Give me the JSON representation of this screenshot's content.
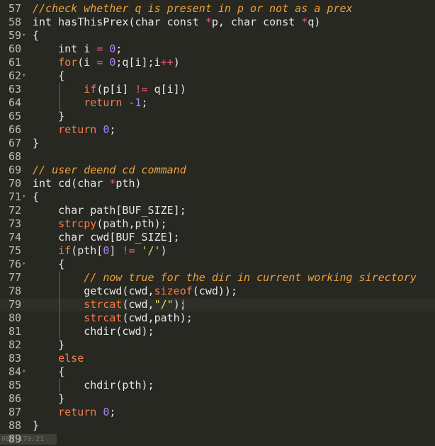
{
  "lines": [
    {
      "n": "57",
      "segs": [
        {
          "t": "//check whether q is present in p or not as a prex",
          "c": "cm"
        }
      ]
    },
    {
      "n": "58",
      "segs": [
        {
          "t": "int hasThisPrex(char const ",
          "c": ""
        },
        {
          "t": "*",
          "c": "op"
        },
        {
          "t": "p, char const ",
          "c": ""
        },
        {
          "t": "*",
          "c": "op"
        },
        {
          "t": "q)",
          "c": ""
        }
      ]
    },
    {
      "n": "59",
      "fold": true,
      "segs": [
        {
          "t": "{",
          "c": ""
        }
      ]
    },
    {
      "n": "60",
      "segs": [
        {
          "t": "    int i ",
          "c": ""
        },
        {
          "t": "=",
          "c": "op"
        },
        {
          "t": " ",
          "c": ""
        },
        {
          "t": "0",
          "c": "num"
        },
        {
          "t": ";",
          "c": ""
        }
      ]
    },
    {
      "n": "61",
      "segs": [
        {
          "t": "    ",
          "c": ""
        },
        {
          "t": "for",
          "c": "kw"
        },
        {
          "t": "(i ",
          "c": ""
        },
        {
          "t": "=",
          "c": "op"
        },
        {
          "t": " ",
          "c": ""
        },
        {
          "t": "0",
          "c": "num"
        },
        {
          "t": ";q[i];i",
          "c": ""
        },
        {
          "t": "++",
          "c": "op"
        },
        {
          "t": ")",
          "c": ""
        }
      ]
    },
    {
      "n": "62",
      "fold": true,
      "segs": [
        {
          "t": "    {",
          "c": ""
        }
      ]
    },
    {
      "n": "63",
      "segs": [
        {
          "t": "        ",
          "c": ""
        },
        {
          "t": "if",
          "c": "kw"
        },
        {
          "t": "(p[i] ",
          "c": ""
        },
        {
          "t": "!=",
          "c": "op"
        },
        {
          "t": " q[i])",
          "c": ""
        }
      ]
    },
    {
      "n": "64",
      "segs": [
        {
          "t": "        ",
          "c": ""
        },
        {
          "t": "return",
          "c": "kw"
        },
        {
          "t": " ",
          "c": ""
        },
        {
          "t": "-1",
          "c": "num"
        },
        {
          "t": ";",
          "c": ""
        }
      ]
    },
    {
      "n": "65",
      "segs": [
        {
          "t": "    }",
          "c": ""
        }
      ]
    },
    {
      "n": "66",
      "segs": [
        {
          "t": "    ",
          "c": ""
        },
        {
          "t": "return",
          "c": "kw"
        },
        {
          "t": " ",
          "c": ""
        },
        {
          "t": "0",
          "c": "num"
        },
        {
          "t": ";",
          "c": ""
        }
      ]
    },
    {
      "n": "67",
      "segs": [
        {
          "t": "}",
          "c": ""
        }
      ]
    },
    {
      "n": "68",
      "segs": []
    },
    {
      "n": "69",
      "segs": [
        {
          "t": "// user deend cd command",
          "c": "cm"
        }
      ]
    },
    {
      "n": "70",
      "segs": [
        {
          "t": "int cd(char ",
          "c": ""
        },
        {
          "t": "*",
          "c": "op"
        },
        {
          "t": "pth)",
          "c": ""
        }
      ]
    },
    {
      "n": "71",
      "fold": true,
      "segs": [
        {
          "t": "{",
          "c": ""
        }
      ]
    },
    {
      "n": "72",
      "segs": [
        {
          "t": "    char path[BUF_SIZE];",
          "c": ""
        }
      ]
    },
    {
      "n": "73",
      "segs": [
        {
          "t": "    ",
          "c": ""
        },
        {
          "t": "strcpy",
          "c": "kw"
        },
        {
          "t": "(path,pth);",
          "c": ""
        }
      ]
    },
    {
      "n": "74",
      "segs": [
        {
          "t": "    char cwd[BUF_SIZE];",
          "c": ""
        }
      ]
    },
    {
      "n": "75",
      "segs": [
        {
          "t": "    ",
          "c": ""
        },
        {
          "t": "if",
          "c": "kw"
        },
        {
          "t": "(pth[",
          "c": ""
        },
        {
          "t": "0",
          "c": "num"
        },
        {
          "t": "] ",
          "c": ""
        },
        {
          "t": "!=",
          "c": "op"
        },
        {
          "t": " ",
          "c": ""
        },
        {
          "t": "'/'",
          "c": "str"
        },
        {
          "t": ")",
          "c": ""
        }
      ]
    },
    {
      "n": "76",
      "fold": true,
      "segs": [
        {
          "t": "    {",
          "c": ""
        }
      ]
    },
    {
      "n": "77",
      "segs": [
        {
          "t": "        // now true for the dir in current working sirectory",
          "c": "cm"
        }
      ]
    },
    {
      "n": "78",
      "segs": [
        {
          "t": "        getcwd(cwd,",
          "c": ""
        },
        {
          "t": "sizeof",
          "c": "kw"
        },
        {
          "t": "(cwd));",
          "c": ""
        }
      ]
    },
    {
      "n": "79",
      "active": true,
      "segs": [
        {
          "t": "        ",
          "c": ""
        },
        {
          "t": "strcat",
          "c": "kw"
        },
        {
          "t": "(cwd,",
          "c": ""
        },
        {
          "t": "\"/\"",
          "c": "str"
        },
        {
          "t": ");",
          "c": ""
        }
      ]
    },
    {
      "n": "80",
      "segs": [
        {
          "t": "        ",
          "c": ""
        },
        {
          "t": "strcat",
          "c": "kw"
        },
        {
          "t": "(cwd,path);",
          "c": ""
        }
      ]
    },
    {
      "n": "81",
      "segs": [
        {
          "t": "        chdir(cwd);",
          "c": ""
        }
      ]
    },
    {
      "n": "82",
      "segs": [
        {
          "t": "    }",
          "c": ""
        }
      ]
    },
    {
      "n": "83",
      "segs": [
        {
          "t": "    ",
          "c": ""
        },
        {
          "t": "else",
          "c": "kw"
        }
      ]
    },
    {
      "n": "84",
      "fold": true,
      "segs": [
        {
          "t": "    {",
          "c": ""
        }
      ]
    },
    {
      "n": "85",
      "segs": [
        {
          "t": "        chdir(pth);",
          "c": ""
        }
      ]
    },
    {
      "n": "86",
      "segs": [
        {
          "t": "    }",
          "c": ""
        }
      ]
    },
    {
      "n": "87",
      "segs": [
        {
          "t": "    ",
          "c": ""
        },
        {
          "t": "return",
          "c": "kw"
        },
        {
          "t": " ",
          "c": ""
        },
        {
          "t": "0",
          "c": "num"
        },
        {
          "t": ";",
          "c": ""
        }
      ]
    },
    {
      "n": "88",
      "segs": [
        {
          "t": "}",
          "c": ""
        }
      ]
    },
    {
      "n": "89",
      "segs": []
    }
  ],
  "fold_glyph": "▾",
  "status_text": "089:179:21"
}
